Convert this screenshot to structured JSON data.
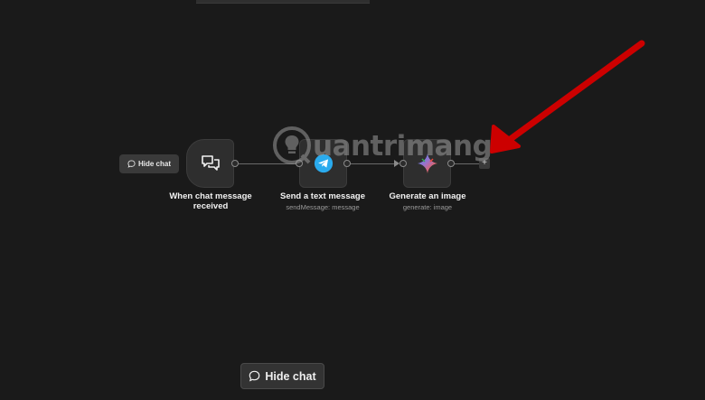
{
  "small_hide_chat": {
    "label": "Hide chat",
    "icon": "chat-bubble-icon"
  },
  "big_hide_chat": {
    "label": "Hide chat",
    "icon": "chat-bubble-icon"
  },
  "nodes": [
    {
      "title": "When chat message received",
      "subtitle": "",
      "icon": "chat-trigger-icon"
    },
    {
      "title": "Send a text message",
      "subtitle": "sendMessage: message",
      "icon": "telegram-icon"
    },
    {
      "title": "Generate an image",
      "subtitle": "generate: image",
      "icon": "gemini-icon"
    }
  ],
  "add_node": {
    "label": "+"
  },
  "watermark": {
    "text": "uantrimang"
  },
  "colors": {
    "canvas": "#1a1a1a",
    "node_bg": "#2e2e2e",
    "telegram": "#2AABEE",
    "annotation_arrow": "#cc0000"
  }
}
